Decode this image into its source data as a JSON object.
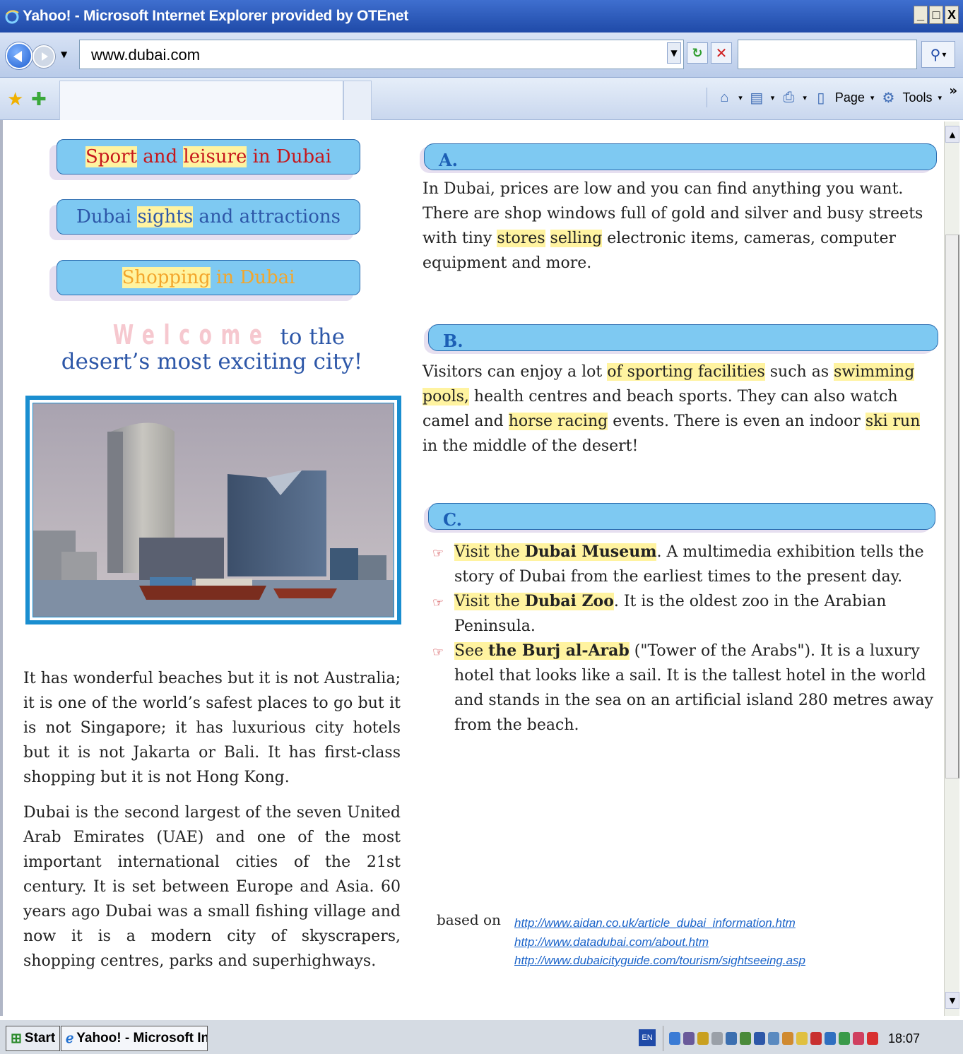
{
  "window": {
    "title": "Yahoo! - Microsoft Internet Explorer provided by OTEnet",
    "min": "_",
    "max": "□",
    "close": "X"
  },
  "address_bar": {
    "url": "www.dubai.com",
    "search_value": ""
  },
  "command_bar": {
    "page_label": "Page",
    "tools_label": "Tools",
    "more": "»"
  },
  "nav_pills": [
    {
      "parts": [
        {
          "text": "Sport",
          "hl": true
        },
        {
          "text": " and ",
          "hl": false
        },
        {
          "text": "leisure",
          "hl": true
        },
        {
          "text": " in Dubai",
          "hl": false
        }
      ]
    },
    {
      "parts": [
        {
          "text": "Dubai ",
          "hl": false
        },
        {
          "text": "sights",
          "hl": true
        },
        {
          "text": " and attractions",
          "hl": false
        }
      ]
    },
    {
      "parts": [
        {
          "text": "Shopping",
          "hl": true
        },
        {
          "text": " in Dubai",
          "hl": false
        }
      ]
    }
  ],
  "welcome": {
    "big": "Welcome",
    "to": "to the",
    "line2": "desert’s most exciting city!"
  },
  "photo": {
    "caption_mark": ""
  },
  "left_paragraphs": [
    "It has wonderful beaches but it is not Australia; it is one of the world’s safest places to go but it is not Singapore; it has luxurious city hotels but it is not Jakarta or Bali. It has first-class shopping but it is not Hong Kong.",
    "Dubai is the second largest of the seven United Arab Emirates (UAE) and one of the most important international cities of the 21st century. It is set between Europe and Asia. 60 years ago Dubai was a small fishing village and now it is a modern city of skyscrapers, shopping centres, parks and superhighways."
  ],
  "section_a": {
    "heading": "A.",
    "parts": [
      {
        "text": "In Dubai, prices are low and you can find anything you want. There are shop windows full of gold and silver and busy streets with tiny ",
        "hl": false
      },
      {
        "text": "stores",
        "hl": true
      },
      {
        "text": " ",
        "hl": false
      },
      {
        "text": "selling",
        "hl": true
      },
      {
        "text": " electronic items, cameras, computer equipment and more.",
        "hl": false
      }
    ]
  },
  "section_b": {
    "heading": "B.",
    "parts": [
      {
        "text": "Visitors can enjoy a lot ",
        "hl": false
      },
      {
        "text": "of sporting facilities",
        "hl": true
      },
      {
        "text": " such as ",
        "hl": false
      },
      {
        "text": "swimming pools,",
        "hl": true
      },
      {
        "text": " health centres and beach sports. They can also watch camel and ",
        "hl": false
      },
      {
        "text": "horse racing",
        "hl": true
      },
      {
        "text": " events. There is even an indoor ",
        "hl": false
      },
      {
        "text": "ski run",
        "hl": true
      },
      {
        "text": " in the middle of the desert!",
        "hl": false
      }
    ]
  },
  "section_c": {
    "heading": "C.",
    "items": [
      {
        "lead": "Visit the ",
        "bold": "Dubai Museum",
        "rest": ". A multimedia exhibition tells the story of Dubai from the earliest times to the present day."
      },
      {
        "lead": "Visit the ",
        "bold": "Dubai Zoo",
        "rest": ". It is the oldest zoo in the Arabian Peninsula."
      },
      {
        "lead": "See ",
        "bold": "the Burj al-Arab",
        "rest": " (\"Tower of the Arabs\"). It is a luxury hotel that looks like a sail. It is the tallest hotel in the world and stands in the sea on an artificial island 280 metres away from the beach."
      }
    ]
  },
  "sources": {
    "label": "based on",
    "links": [
      "http://www.aidan.co.uk/article_dubai_information.htm",
      "http://www.datadubai.com/about.htm",
      "http://www.dubaicityguide.com/tourism/sightseeing.asp"
    ]
  },
  "taskbar": {
    "start_label": "Start",
    "task_label": "Yahoo! - Microsoft Int...",
    "language": "EN",
    "clock": "18:07"
  },
  "colors": {
    "pill_blue": "#7ec9f2",
    "highlight": "#fff3a0",
    "red_text": "#c6171c",
    "blue_text": "#2d57a8",
    "orange_text": "#f3a62c",
    "link": "#1a63c9"
  }
}
